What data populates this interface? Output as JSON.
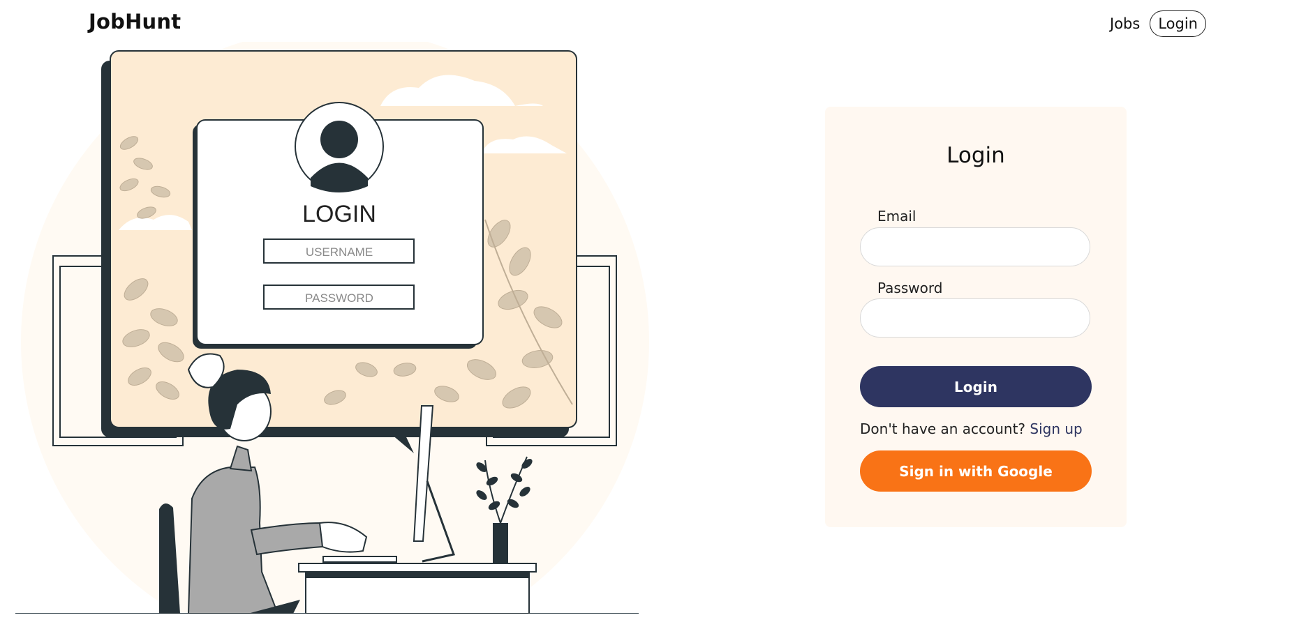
{
  "header": {
    "brand": "JobHunt",
    "nav": {
      "jobs": "Jobs",
      "login": "Login"
    }
  },
  "illustration": {
    "heading": "LOGIN",
    "username_placeholder": "USERNAME",
    "password_placeholder": "PASSWORD"
  },
  "login_card": {
    "title": "Login",
    "email_label": "Email",
    "email_value": "",
    "password_label": "Password",
    "password_value": "",
    "login_button": "Login",
    "signup_prompt": "Don't have an account?",
    "signup_link": "Sign up",
    "google_button": "Sign in with Google"
  },
  "colors": {
    "primary": "#2e3561",
    "google": "#f97316",
    "card_bg": "#fff8f1",
    "illustration_bg": "#fdebd3"
  }
}
